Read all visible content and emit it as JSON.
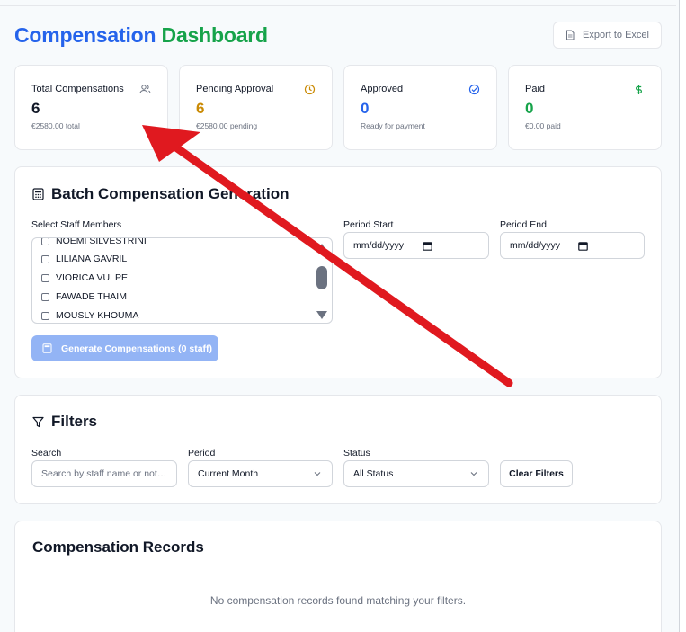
{
  "header": {
    "title_part1": "Compensation",
    "title_part2": "Dashboard",
    "export_label": "Export to Excel"
  },
  "stats": [
    {
      "label": "Total Compensations",
      "value": "6",
      "sub": "€2580.00 total",
      "icon": "users-icon",
      "color": "#111827"
    },
    {
      "label": "Pending Approval",
      "value": "6",
      "sub": "€2580.00 pending",
      "icon": "clock-icon",
      "color": "#ca8a04"
    },
    {
      "label": "Approved",
      "value": "0",
      "sub": "Ready for payment",
      "icon": "check-circle-icon",
      "color": "#2563eb"
    },
    {
      "label": "Paid",
      "value": "0",
      "sub": "€0.00 paid",
      "icon": "dollar-icon",
      "color": "#16a34a"
    }
  ],
  "batch": {
    "title": "Batch Compensation Generation",
    "staff_label": "Select Staff Members",
    "staff": [
      "NOEMI SILVESTRINI",
      "LILIANA GAVRIL",
      "VIORICA VULPE",
      "FAWADE THAIM",
      "MOUSLY KHOUMA"
    ],
    "period_start_label": "Period Start",
    "period_end_label": "Period End",
    "date_placeholder": "mm/dd/yyyy",
    "generate_label": "Generate Compensations (0 staff)"
  },
  "filters": {
    "title": "Filters",
    "search_label": "Search",
    "search_placeholder": "Search by staff name or notes...",
    "period_label": "Period",
    "period_value": "Current Month",
    "status_label": "Status",
    "status_value": "All Status",
    "clear_label": "Clear Filters"
  },
  "records": {
    "title": "Compensation Records",
    "empty_message": "No compensation records found matching your filters."
  },
  "colors": {
    "brand_blue": "#2563eb",
    "brand_green": "#16a34a",
    "annotation_arrow": "#e0191f"
  }
}
